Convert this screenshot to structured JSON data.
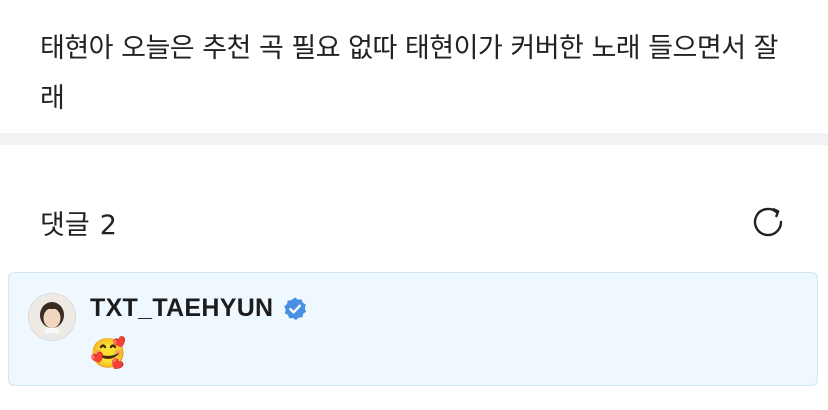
{
  "post": {
    "body": "태현아 오늘은 추천 곡 필요 없따 태현이가 커버한 노래 들으면서 잘래"
  },
  "comments": {
    "title": "댓글",
    "count": "2",
    "refresh_icon": "refresh-icon"
  },
  "comment_list": [
    {
      "author": "TXT_TAEHYUN",
      "verified": true,
      "verified_icon": "verified-badge-icon",
      "text": "🥰"
    }
  ],
  "colors": {
    "card_background": "#eef8fe",
    "card_border": "#d3e6f3",
    "verified_badge": "#4a90e2",
    "divider": "#f2f2f4"
  }
}
